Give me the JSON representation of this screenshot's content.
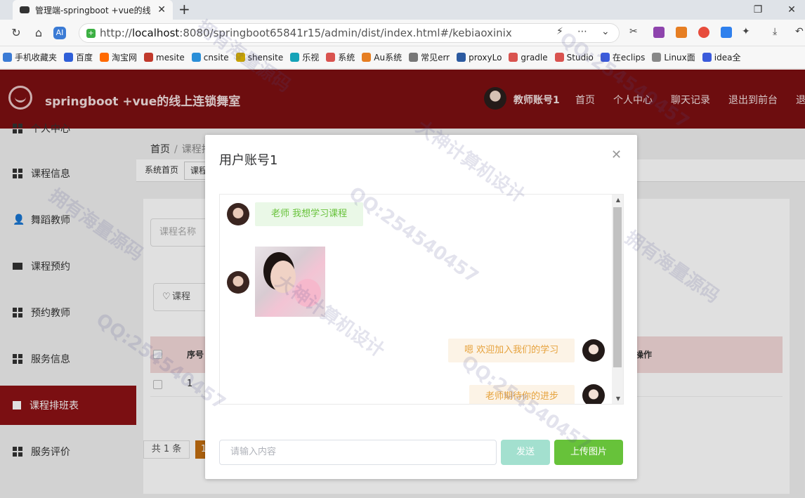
{
  "browser": {
    "tab_title": "管理端-springboot +vue的线",
    "tab_close": "✕",
    "new_tab": "+",
    "url_scheme": "http://",
    "url_host": "localhost",
    "url_path": ":8080/springboot65841r15/admin/dist/index.html#/kebiaoxinix",
    "bookmarks": [
      {
        "label": "手机收藏夹",
        "color": "#3b7bd5"
      },
      {
        "label": "百度",
        "color": "#2f5fd8"
      },
      {
        "label": "淘宝网",
        "color": "#ff6a00"
      },
      {
        "label": "mesite",
        "color": "#c0392b"
      },
      {
        "label": "cnsite",
        "color": "#2b8fd8"
      },
      {
        "label": "shensite",
        "color": "#c9a400"
      },
      {
        "label": "乐视",
        "color": "#16a3b8"
      },
      {
        "label": "系统",
        "color": "#d9534f"
      },
      {
        "label": "Au系统",
        "color": "#e67e22"
      },
      {
        "label": "常见err",
        "color": "#777777"
      },
      {
        "label": "proxyLo",
        "color": "#2c5aa0"
      },
      {
        "label": "gradle",
        "color": "#d9534f"
      },
      {
        "label": "Studio",
        "color": "#d9534f"
      },
      {
        "label": "在eclips",
        "color": "#3b5bdb"
      },
      {
        "label": "Linux面",
        "color": "#888888"
      },
      {
        "label": "idea全",
        "color": "#3b5bdb"
      }
    ]
  },
  "header": {
    "title": "springboot +vue的线上连锁舞室",
    "username": "教师账号1",
    "nav": [
      "首页",
      "个人中心",
      "聊天记录",
      "退出到前台",
      "退出登录"
    ]
  },
  "sidebar": {
    "items": [
      {
        "label": "个人中心"
      },
      {
        "label": "课程信息"
      },
      {
        "label": "舞蹈教师"
      },
      {
        "label": "课程预约"
      },
      {
        "label": "预约教师"
      },
      {
        "label": "服务信息"
      },
      {
        "label": "课程排班表"
      },
      {
        "label": "服务评价"
      }
    ]
  },
  "main": {
    "breadcrumb": [
      "首页",
      "课程排班表"
    ],
    "tags": [
      "系统首页",
      "课程排班表"
    ],
    "search_placeholder": "课程名称",
    "fav_button": "课程",
    "table_head": [
      "序号",
      "操作"
    ],
    "row_index": "1",
    "pager_total": "共 1 条",
    "pager_page": "1"
  },
  "dialog": {
    "title": "用户账号1",
    "close": "✕",
    "messages": [
      {
        "side": "left",
        "text": "老师 我想学习课程"
      },
      {
        "side": "left",
        "type": "image"
      },
      {
        "side": "right",
        "text": "嗯 欢迎加入我们的学习"
      },
      {
        "side": "right",
        "text": "老师期待你的进步"
      }
    ],
    "input_placeholder": "请输入内容",
    "send_label": "发送",
    "upload_label": "上传图片"
  },
  "watermarks": [
    "拥有海量源码",
    "大神计算机设计",
    "QQ:254540457"
  ],
  "colors": {
    "header_bg": "#7d0f12",
    "sidebar_active": "#8c1215",
    "bubble_left": "#eaf8e7",
    "bubble_right": "#fcf3e6",
    "upload_btn": "#67c23a",
    "send_btn": "#a3e0cf"
  }
}
